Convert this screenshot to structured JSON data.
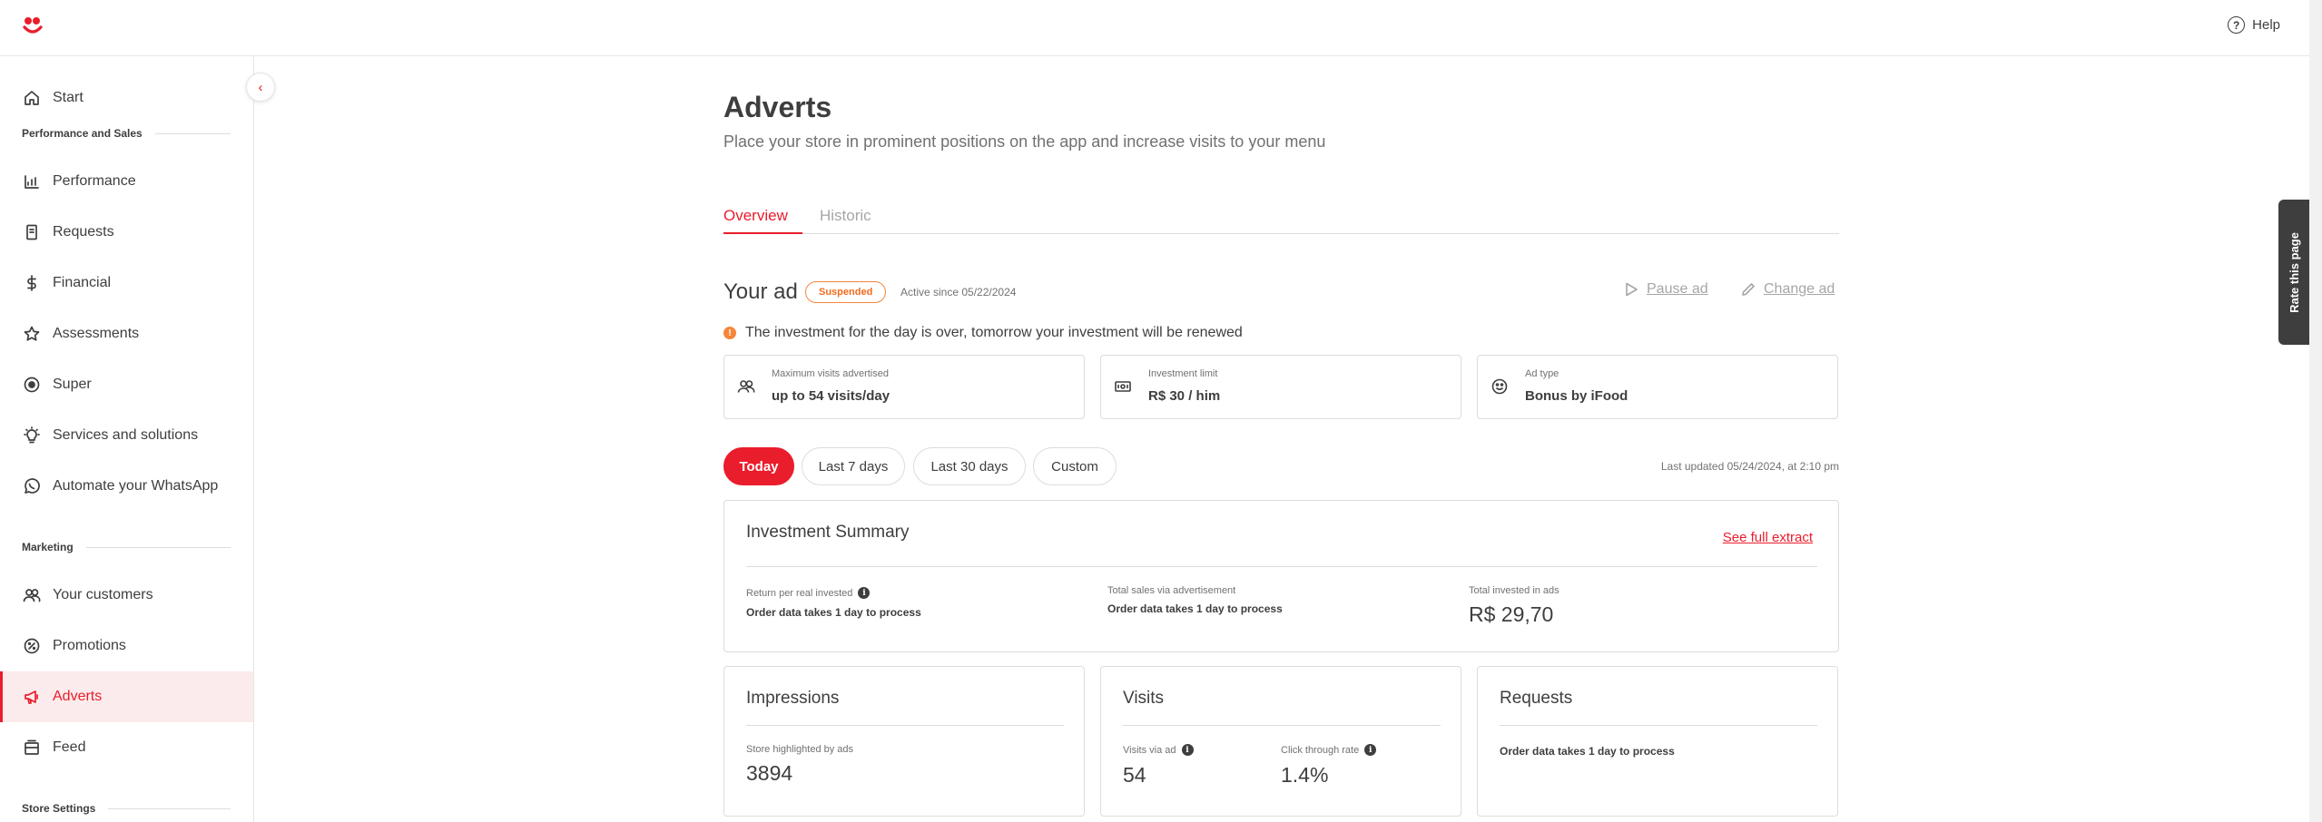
{
  "topbar": {
    "help_label": "Help"
  },
  "sidebar": {
    "items_top": [
      {
        "label": "Start",
        "icon": "home-icon"
      }
    ],
    "section_performance": "Performance and Sales",
    "performance_items": [
      {
        "label": "Performance",
        "icon": "chart-icon"
      },
      {
        "label": "Requests",
        "icon": "receipt-icon"
      },
      {
        "label": "Financial",
        "icon": "dollar-icon"
      },
      {
        "label": "Assessments",
        "icon": "star-icon"
      },
      {
        "label": "Super",
        "icon": "target-icon"
      },
      {
        "label": "Services and solutions",
        "icon": "lightbulb-icon"
      },
      {
        "label": "Automate your WhatsApp",
        "icon": "whatsapp-icon"
      }
    ],
    "section_marketing": "Marketing",
    "marketing_items": [
      {
        "label": "Your customers",
        "icon": "users-icon"
      },
      {
        "label": "Promotions",
        "icon": "percent-icon"
      },
      {
        "label": "Adverts",
        "icon": "megaphone-icon",
        "active": true
      },
      {
        "label": "Feed",
        "icon": "feed-icon"
      }
    ],
    "section_store": "Store Settings"
  },
  "main": {
    "title": "Adverts",
    "subtitle": "Place your store in prominent positions on the app and increase visits to your menu",
    "tabs": [
      {
        "label": "Overview",
        "active": true
      },
      {
        "label": "Historic",
        "active": false
      }
    ],
    "your_ad": {
      "title": "Your ad",
      "badge": "Suspended",
      "active_since": "Active since 05/22/2024",
      "pause_label": "Pause ad",
      "change_label": "Change ad",
      "notice": "The investment for the day is over, tomorrow your investment will be renewed"
    },
    "info_cards": [
      {
        "label": "Maximum visits advertised",
        "value": "up to 54 visits/day",
        "icon": "users-icon"
      },
      {
        "label": "Investment limit",
        "value": "R$ 30 / him",
        "icon": "money-icon"
      },
      {
        "label": "Ad type",
        "value": "Bonus by iFood",
        "icon": "ifood-smile-icon"
      }
    ],
    "filters": [
      "Today",
      "Last 7 days",
      "Last 30 days",
      "Custom"
    ],
    "active_filter": "Today",
    "last_updated": "Last updated 05/24/2024, at 2:10 pm",
    "summary": {
      "title": "Investment Summary",
      "link": "See full extract",
      "return_label": "Return per real invested",
      "return_note": "Order data takes 1 day to process",
      "sales_label": "Total sales via advertisement",
      "sales_note": "Order data takes 1 day to process",
      "invested_label": "Total invested in ads",
      "invested_value": "R$ 29,70"
    },
    "impressions": {
      "title": "Impressions",
      "label": "Store highlighted by ads",
      "value": "3894"
    },
    "visits": {
      "title": "Visits",
      "via_label": "Visits via ad",
      "via_value": "54",
      "ctr_label": "Click through rate",
      "ctr_value": "1.4%"
    },
    "requests": {
      "title": "Requests",
      "note": "Order data takes 1 day to process"
    }
  },
  "rate_label": "Rate this page",
  "colors": {
    "brand": "#ea1d2c",
    "warning": "#f5863b",
    "text": "#3e3e3e",
    "muted": "#717171",
    "border": "#dcdcdc"
  }
}
